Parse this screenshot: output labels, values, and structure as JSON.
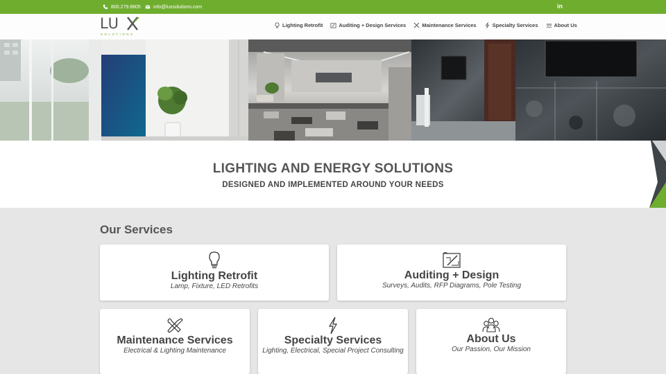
{
  "topbar": {
    "phone": "800.279.8805",
    "email": "info@luxsolutions.com",
    "social_label": "in"
  },
  "logo": {
    "text": "LU",
    "subtext": "SOLUTIONS"
  },
  "nav": [
    {
      "label": "Lighting Retrofit",
      "icon": "bulb-icon"
    },
    {
      "label": "Auditing + Design Services",
      "icon": "blueprint-icon"
    },
    {
      "label": "Maintenance Services",
      "icon": "tools-icon"
    },
    {
      "label": "Specialty Services",
      "icon": "bolt-icon"
    },
    {
      "label": "About Us",
      "icon": "team-icon"
    }
  ],
  "banner": {
    "title": "LIGHTING AND ENERGY SOLUTIONS",
    "subtitle": "DESIGNED AND IMPLEMENTED AROUND YOUR NEEDS"
  },
  "services": {
    "heading": "Our Services",
    "cards": [
      {
        "title": "Lighting Retrofit",
        "subtitle": "Lamp, Fixture, LED Retrofits",
        "icon": "bulb-icon"
      },
      {
        "title": "Auditing + Design",
        "subtitle": "Surveys, Audits, RFP Diagrams, Pole Testing",
        "icon": "blueprint-icon"
      },
      {
        "title": "Maintenance Services",
        "subtitle": "Electrical & Lighting Maintenance",
        "icon": "tools-icon"
      },
      {
        "title": "Specialty Services",
        "subtitle": "Lighting, Electrical, Special Project Consulting",
        "icon": "bolt-icon"
      },
      {
        "title": "About Us",
        "subtitle": "Our Passion, Our Mission",
        "icon": "team-icon"
      }
    ]
  },
  "colors": {
    "brand_green": "#6fad2f",
    "text_dark": "#444444",
    "panel_bg": "#e6e6e6"
  }
}
